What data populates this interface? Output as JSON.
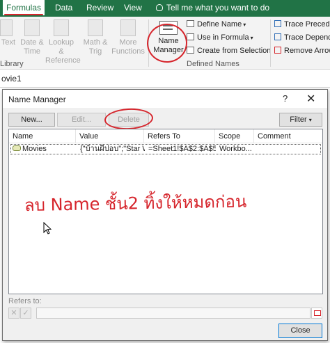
{
  "ribbon": {
    "tabs": [
      "Formulas",
      "Data",
      "Review",
      "View"
    ],
    "tell_me": "Tell me what you want to do",
    "library_buttons": [
      {
        "label": "Text"
      },
      {
        "label": "Date &\nTime"
      },
      {
        "label": "Lookup &\nReference"
      },
      {
        "label": "Math &\nTrig"
      },
      {
        "label": "More\nFunctions"
      }
    ],
    "library_group_label": "Library",
    "name_manager": "Name\nManager",
    "define_name": "Define Name",
    "use_in_formula": "Use in Formula",
    "create_from_selection": "Create from Selection",
    "defined_names_group": "Defined Names",
    "trace_precedents": "Trace Preceden",
    "trace_dependents": "Trace Depende",
    "remove_arrows": "Remove Arrow"
  },
  "formula_bar": {
    "name_box": "ovie1"
  },
  "dialog": {
    "title": "Name Manager",
    "help": "?",
    "close_x": "✕",
    "buttons": {
      "new": "New...",
      "edit": "Edit...",
      "delete": "Delete",
      "filter": "Filter"
    },
    "columns": [
      "Name",
      "Value",
      "Refers To",
      "Scope",
      "Comment"
    ],
    "rows": [
      {
        "name": "Movies",
        "value": "{\"บ้านผีปอบ\";\"Star W...",
        "refers_to": "=Sheet1!$A$2:$A$5",
        "scope": "Workbo...",
        "comment": ""
      }
    ],
    "annotation": "ลบ Name ชั้น2 ทิ้งให้หมดก่อน",
    "refers_to_label": "Refers to:",
    "close_button": "Close"
  },
  "colors": {
    "excel_green": "#217346",
    "annotation_red": "#d6252c"
  },
  "icons": [
    "bulb-icon",
    "name-manager-icon",
    "define-name-icon",
    "use-in-formula-icon",
    "create-from-selection-icon",
    "trace-precedents-icon",
    "trace-dependents-icon",
    "remove-arrows-icon",
    "name-tag-icon",
    "cursor-icon",
    "collapse-dialog-icon"
  ]
}
